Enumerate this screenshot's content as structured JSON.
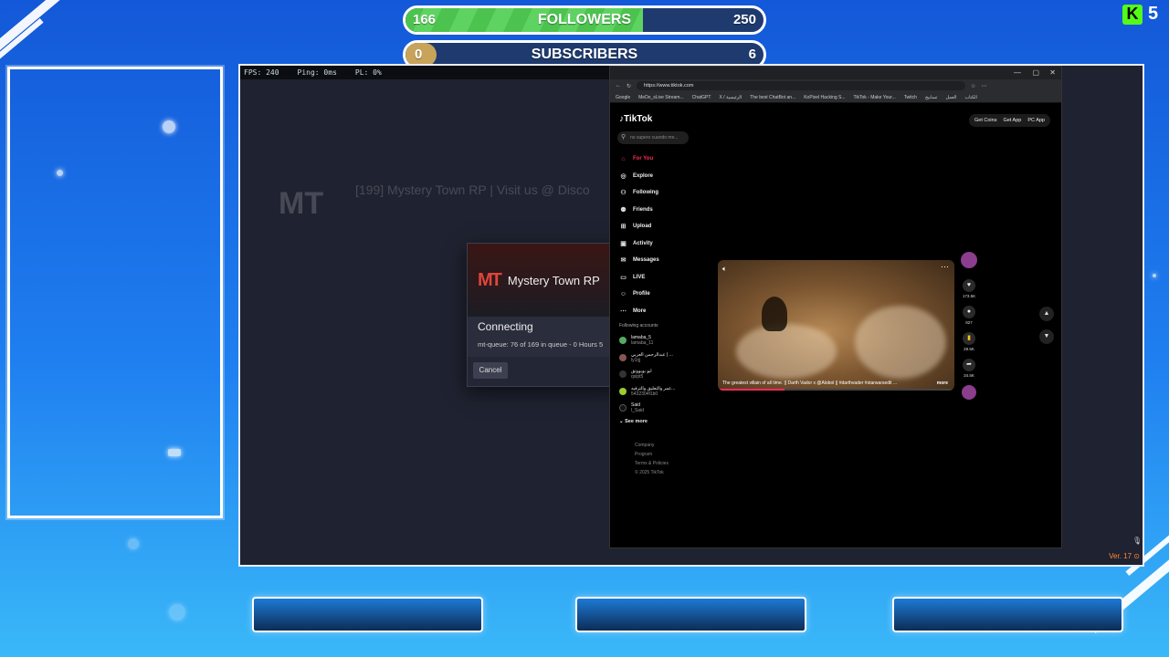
{
  "goals": {
    "followers": {
      "current": "166",
      "label": "FOLLOWERS",
      "target": "250",
      "progress": 0.664
    },
    "subscribers": {
      "current": "0",
      "label": "SUBSCRIBERS",
      "target": "6",
      "progress": 0.0
    }
  },
  "kick": {
    "logo": "K",
    "count": "5"
  },
  "game": {
    "stats": [
      "FPS: 240",
      "Ping: 0ms",
      "PL: 0%"
    ],
    "server_title": "[199] Mystery Town RP | Visit us @ Disco",
    "dialog": {
      "logo": "MT",
      "title": "Mystery Town RP",
      "status": "Connecting",
      "queue": "mt-queue: 76 of 169 in queue - 0 Hours 5",
      "cancel": "Cancel"
    },
    "version": "Ver. 17"
  },
  "browser": {
    "url": "https://www.tiktok.com",
    "bookmarks": [
      "Google",
      "MeDo_sLive Stream...",
      "ChatGPT",
      "X / الرئيسية",
      "The best ChatBot an...",
      "KoPixel Hacking S...",
      "TikTok - Make Your...",
      "Twitch",
      "تسابيح",
      "العمل",
      "الكتاب"
    ],
    "tiktok": {
      "logo": "TikTok",
      "actions": [
        "Get Coins",
        "Get App",
        "PC App"
      ],
      "search_placeholder": "no supero cuando me...",
      "nav": [
        {
          "label": "For You",
          "icon": "home-icon"
        },
        {
          "label": "Explore",
          "icon": "compass-icon"
        },
        {
          "label": "Following",
          "icon": "user-plus-icon"
        },
        {
          "label": "Friends",
          "icon": "friends-icon"
        },
        {
          "label": "Upload",
          "icon": "upload-icon"
        },
        {
          "label": "Activity",
          "icon": "inbox-icon"
        },
        {
          "label": "Messages",
          "icon": "message-icon"
        },
        {
          "label": "LIVE",
          "icon": "live-icon"
        },
        {
          "label": "Profile",
          "icon": "profile-icon"
        },
        {
          "label": "More",
          "icon": "more-icon"
        }
      ],
      "following_header": "Following accounts",
      "accounts": [
        {
          "name": "lamaba_5",
          "handle": "lamaba_11"
        },
        {
          "name": "عبدالرحمن العربي | ...",
          "handle": "ly1rjj"
        },
        {
          "name": "ابو بوبووتق",
          "handle": "qxipt5"
        },
        {
          "name": "عمر والتعليق والترفيه...",
          "handle": "5432304f1b0"
        },
        {
          "name": "Said",
          "handle": "l_Said"
        }
      ],
      "see_more": "See more",
      "footer": [
        "Company",
        "Program",
        "Terms & Policies",
        "© 2025 TikTok"
      ],
      "video_caption": "The greatest villain of all time. || Darth Vador x @Alobol || #darthvader #starwarsedit ...",
      "caption_more": "more",
      "counts": [
        "173.5K",
        "927",
        "29.5K",
        "34.5K"
      ]
    }
  }
}
